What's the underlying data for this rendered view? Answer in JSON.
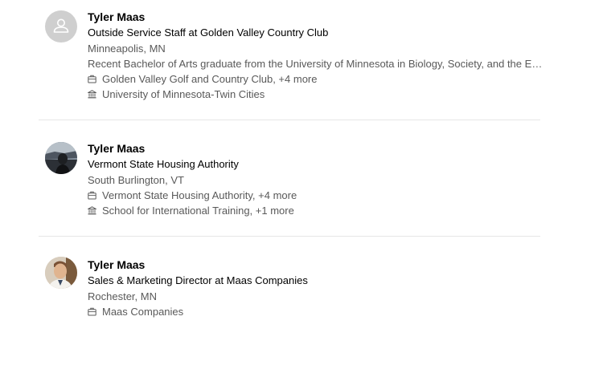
{
  "results": [
    {
      "name": "Tyler Maas",
      "headline": "Outside Service Staff at Golden Valley Country Club",
      "location": "Minneapolis, MN",
      "summary": "Recent Bachelor of Arts graduate from the University of Minnesota in Biology, Society, and the Env…",
      "work": "Golden Valley Golf and Country Club, +4 more",
      "school": "University of Minnesota-Twin Cities",
      "avatar": "placeholder-person-icon"
    },
    {
      "name": "Tyler Maas",
      "headline": "Vermont State Housing Authority",
      "location": "South Burlington, VT",
      "work": "Vermont State Housing Authority, +4 more",
      "school": "School for International Training, +1 more",
      "avatar": "profile-photo"
    },
    {
      "name": "Tyler Maas",
      "headline": "Sales & Marketing Director at Maas Companies",
      "location": "Rochester, MN",
      "work": "Maas Companies",
      "avatar": "profile-photo"
    }
  ],
  "icons": {
    "work": "briefcase-icon",
    "school": "school-building-icon"
  }
}
